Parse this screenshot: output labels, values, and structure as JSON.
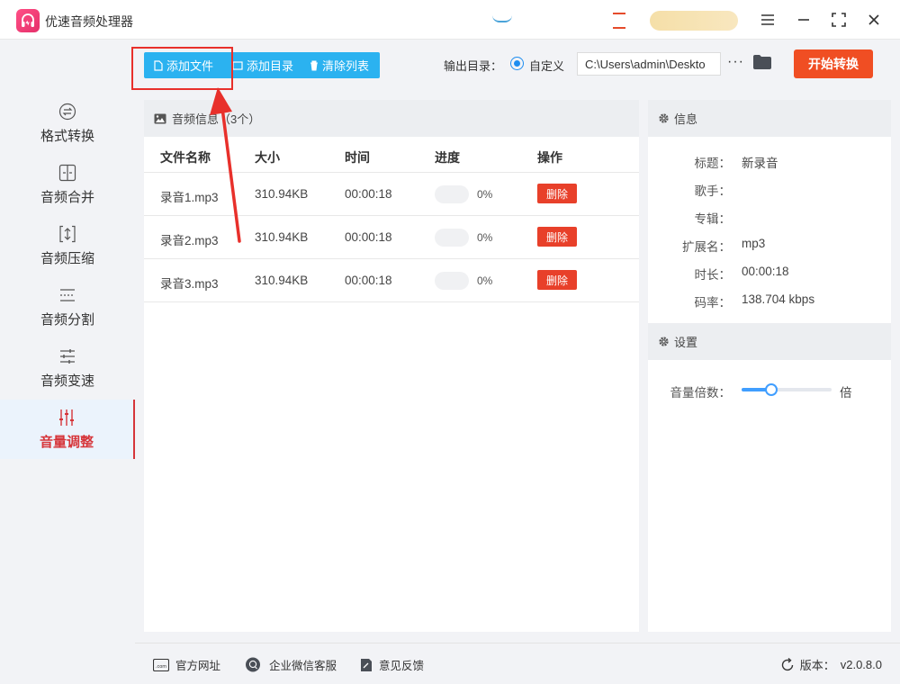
{
  "app": {
    "title": "优速音频处理器"
  },
  "toolbar": {
    "add_file": "添加文件",
    "add_dir": "添加目录",
    "clear_list": "清除列表",
    "output_label": "输出目录：",
    "custom_label": "自定义",
    "output_path": "C:\\Users\\admin\\Deskto",
    "more": "···",
    "start": "开始转换"
  },
  "sidebar": {
    "items": [
      {
        "label": "格式转换",
        "icon": "format-convert-icon"
      },
      {
        "label": "音频合并",
        "icon": "audio-merge-icon"
      },
      {
        "label": "音频压缩",
        "icon": "audio-compress-icon"
      },
      {
        "label": "音频分割",
        "icon": "audio-split-icon"
      },
      {
        "label": "音频变速",
        "icon": "audio-speed-icon"
      },
      {
        "label": "音量调整",
        "icon": "volume-adjust-icon",
        "active": true
      }
    ]
  },
  "files": {
    "header": "音频信息（3个）",
    "columns": [
      "文件名称",
      "大小",
      "时间",
      "进度",
      "操作"
    ],
    "rows": [
      {
        "name": "录音1.mp3",
        "size": "310.94KB",
        "time": "00:00:18",
        "progress": "0%",
        "action": "删除"
      },
      {
        "name": "录音2.mp3",
        "size": "310.94KB",
        "time": "00:00:18",
        "progress": "0%",
        "action": "删除"
      },
      {
        "name": "录音3.mp3",
        "size": "310.94KB",
        "time": "00:00:18",
        "progress": "0%",
        "action": "删除"
      }
    ]
  },
  "info": {
    "header": "信息",
    "fields": [
      {
        "key": "标题：",
        "value": "新录音"
      },
      {
        "key": "歌手：",
        "value": ""
      },
      {
        "key": "专辑：",
        "value": ""
      },
      {
        "key": "扩展名：",
        "value": "mp3"
      },
      {
        "key": "时长：",
        "value": "00:00:18"
      },
      {
        "key": "码率：",
        "value": "138.704 kbps"
      }
    ]
  },
  "settings": {
    "header": "设置",
    "volume_label": "音量倍数：",
    "volume_unit": "倍",
    "volume_level": 0.33
  },
  "footer": {
    "website": "官方网址",
    "wechat": "企业微信客服",
    "feedback": "意见反馈",
    "version_label": "版本：",
    "version": "v2.0.8.0"
  },
  "colors": {
    "accent_blue": "#2bb2f0",
    "start_orange": "#f04e23",
    "active_red": "#d6353a",
    "delete_red": "#e8402a",
    "annotation_red": "#e8302b"
  }
}
